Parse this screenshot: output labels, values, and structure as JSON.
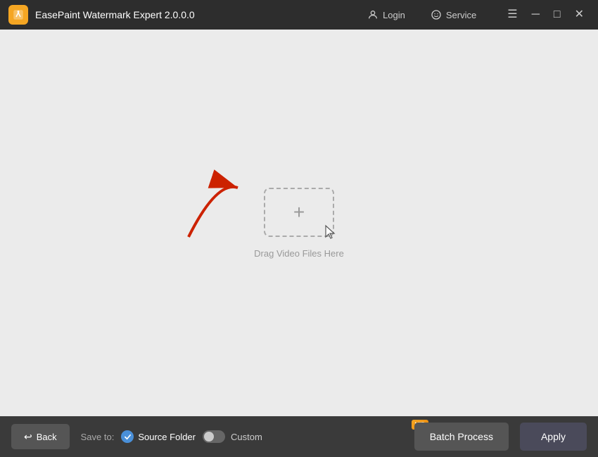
{
  "titlebar": {
    "logo_alt": "EasePaint logo",
    "title": "EasePaint Watermark Expert  2.0.0.0",
    "login_label": "Login",
    "service_label": "Service",
    "menu_icon": "☰",
    "minimize_icon": "─",
    "maximize_icon": "□",
    "close_icon": "✕"
  },
  "main": {
    "drop_label": "Drag Video Files Here",
    "plus_icon": "+"
  },
  "bottombar": {
    "back_label": "Back",
    "back_icon": "↩",
    "save_to_label": "Save to:",
    "source_folder_label": "Source Folder",
    "custom_label": "Custom",
    "batch_process_label": "Batch Process",
    "apply_label": "Apply",
    "vip_label": "VIP"
  }
}
